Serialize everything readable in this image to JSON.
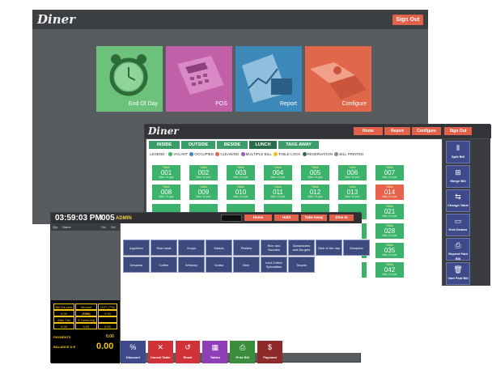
{
  "home": {
    "logo": "Diner",
    "sign_out": "Sign Out",
    "tiles": [
      {
        "label": "End Of Day",
        "color": "#6cc27a",
        "icon": "alarm-clock-icon"
      },
      {
        "label": "POS",
        "color": "#c25fa9",
        "icon": "calculator-icon"
      },
      {
        "label": "Report",
        "color": "#3c88b8",
        "icon": "chart-report-icon"
      },
      {
        "label": "Configure",
        "color": "#e0674a",
        "icon": "puzzle-icon"
      }
    ]
  },
  "tables": {
    "logo": "Diner",
    "header_buttons": [
      "Home",
      "Report",
      "Configure",
      "Sign Out"
    ],
    "tabs": [
      "INSIDE",
      "OUTSIDE",
      "BESIDE",
      "LUNCH",
      "TAKE AWAY"
    ],
    "active_tab": "LUNCH",
    "legend_title": "LEGEND :",
    "legend": [
      {
        "label": "VACANT",
        "color": "#3cb36c"
      },
      {
        "label": "OCCUPIED",
        "color": "#3c88b8"
      },
      {
        "label": "CLEANING",
        "color": "#e2614a"
      },
      {
        "label": "MULTIPLE BILL",
        "color": "#9b59b6"
      },
      {
        "label": "TABLE LOCK",
        "color": "#f1c40f"
      },
      {
        "label": "RESERVATION",
        "color": "#2a6b4a"
      },
      {
        "label": "BILL PRINTED",
        "color": "#7f8c8d"
      }
    ],
    "table_caption": "Table",
    "table_sub": "Max 10 pax",
    "rows": [
      [
        "001",
        "002",
        "003",
        "004",
        "005",
        "006",
        "007"
      ],
      [
        "008",
        "009",
        "010",
        "011",
        "012",
        "013",
        "014"
      ],
      [
        "",
        "",
        "",
        "",
        "",
        "",
        "021"
      ],
      [
        "",
        "",
        "",
        "",
        "",
        "",
        "028"
      ],
      [
        "",
        "",
        "",
        "",
        "",
        "",
        "035"
      ],
      [
        "",
        "",
        "",
        "",
        "",
        "",
        "042"
      ]
    ],
    "busy_tables": [
      "014"
    ],
    "side_buttons": [
      {
        "label": "Split Bill",
        "icon": "split-icon"
      },
      {
        "label": "Merge Bill",
        "icon": "merge-icon"
      },
      {
        "label": "Change Table",
        "icon": "swap-arrows-icon"
      },
      {
        "label": "Kick Drawer",
        "icon": "drawer-icon"
      },
      {
        "label": "Reprint Paid Bill",
        "icon": "printer-icon"
      },
      {
        "label": "Void Paid Bill",
        "icon": "trash-icon"
      }
    ]
  },
  "pos": {
    "time": "03:59:03 PM",
    "terminal": "005",
    "user": "ADMIN",
    "top_buttons": [
      "Home",
      "Hold",
      "Take Away",
      "Dine In"
    ],
    "columns": [
      "Qty",
      "Name",
      "Sel",
      "Sel"
    ],
    "summary_cells": [
      "Bill Dis.cent",
      "Service (10%)",
      "GST (7%)",
      "After Tax",
      "S.Cents Adj",
      ""
    ],
    "summary_values": [
      "0.00",
      "0.00",
      "0.00",
      "0.00",
      "0.00",
      "0.00"
    ],
    "payments_label": "PAYMENTS",
    "payments_value": "0.00",
    "balance_label": "BALANCE D.E",
    "balance_value": "0.00",
    "categories_row1": [
      "Appetizer",
      "Raw meat",
      "Soups",
      "Salads",
      "Platters",
      "Rice and Noodles",
      "Sandwiches and Burgers",
      "Dish of the day",
      "Dessishe"
    ],
    "categories_row2": [
      "Desserts",
      "Coffee",
      "Whiskey",
      "Vodka",
      "Beer",
      "Iced Coffee Specialties",
      "Tequila"
    ],
    "bottom_buttons": [
      {
        "label": "Discount",
        "color": "#3e4a8a",
        "icon": "percent-icon"
      },
      {
        "label": "Cancel Table",
        "color": "#d1323a",
        "icon": "close-icon"
      },
      {
        "label": "Reset",
        "color": "#d1323a",
        "icon": "reset-icon"
      },
      {
        "label": "Tables",
        "color": "#8e3fb5",
        "icon": "tables-icon"
      },
      {
        "label": "Print Bill",
        "color": "#3c8c3e",
        "icon": "printer-icon"
      },
      {
        "label": "Payment",
        "color": "#8e2a2a",
        "icon": "payment-icon"
      }
    ]
  }
}
